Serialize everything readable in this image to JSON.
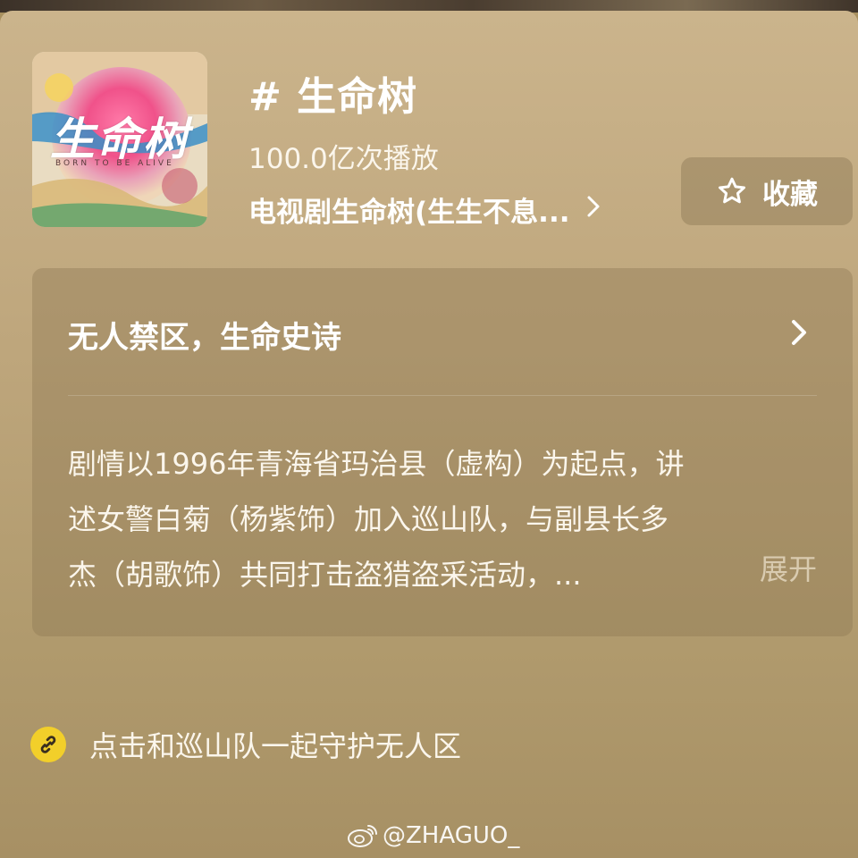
{
  "topic": {
    "title": "# 生命树",
    "plays": "100.0亿次播放",
    "series_link": "电视剧生命树(生生不息...",
    "cover_logo_text": "生命树",
    "cover_subtext": "BORN TO BE ALIVE"
  },
  "favorite_button": {
    "label": "收藏",
    "icon": "star-outline-icon"
  },
  "card": {
    "headline": "无人禁区，生命史诗",
    "description_lines": [
      "剧情以1996年青海省玛治县（虚构）为起点，讲",
      "述女警白菊（杨紫饰）加入巡山队，与副县长多",
      "杰（胡歌饰）共同打击盗猎盗采活动，..."
    ],
    "expand_label": "展开"
  },
  "link": {
    "text": "点击和巡山队一起守护无人区",
    "icon": "link-icon",
    "icon_color": "#f2cf2a"
  },
  "watermark": {
    "text": "@ZHAGUO_",
    "icon": "weibo-icon"
  },
  "colors": {
    "panel_top": "#cbb48c",
    "panel_bottom": "#a79064",
    "text": "#ffffff"
  }
}
